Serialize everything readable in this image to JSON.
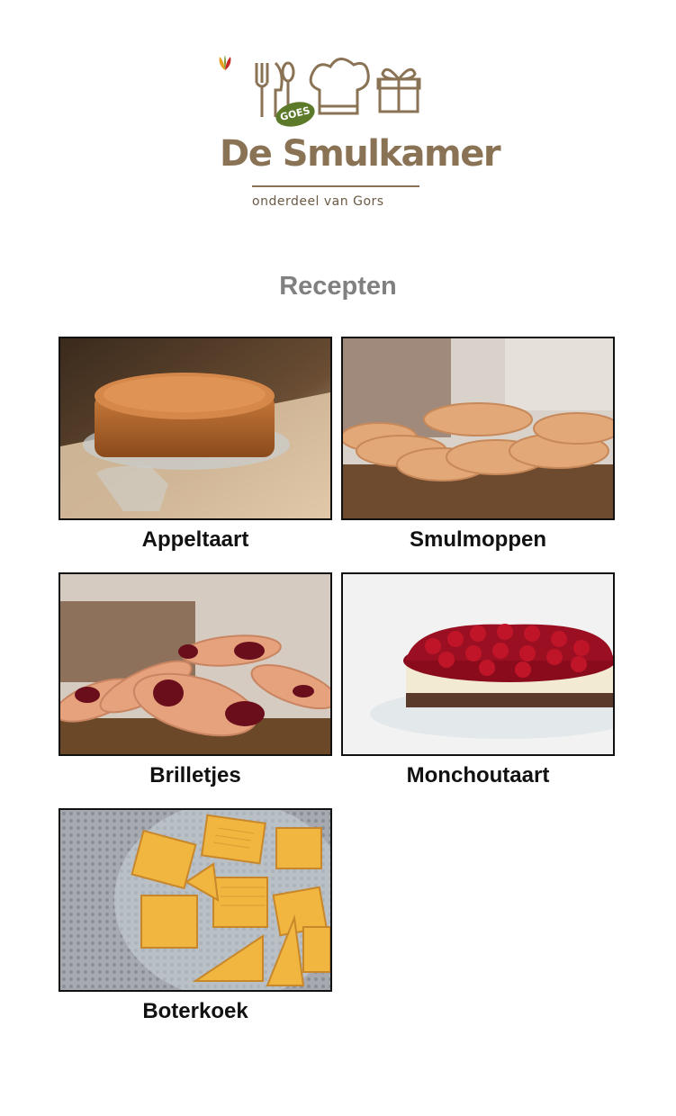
{
  "brand": {
    "badge": "GOES",
    "name": "De Smulkamer",
    "tagline": "onderdeel van Gors",
    "color": "#8a7355",
    "accent_green": "#5d7a2a"
  },
  "page_title": "Recepten",
  "recipes": [
    {
      "name": "Appeltaart",
      "image": "apple-pie-photo"
    },
    {
      "name": "Smulmoppen",
      "image": "cookies-photo"
    },
    {
      "name": "Brilletjes",
      "image": "jam-cookies-photo"
    },
    {
      "name": "Monchoutaart",
      "image": "cherry-cheesecake-photo"
    },
    {
      "name": "Boterkoek",
      "image": "butter-cake-photo"
    }
  ]
}
